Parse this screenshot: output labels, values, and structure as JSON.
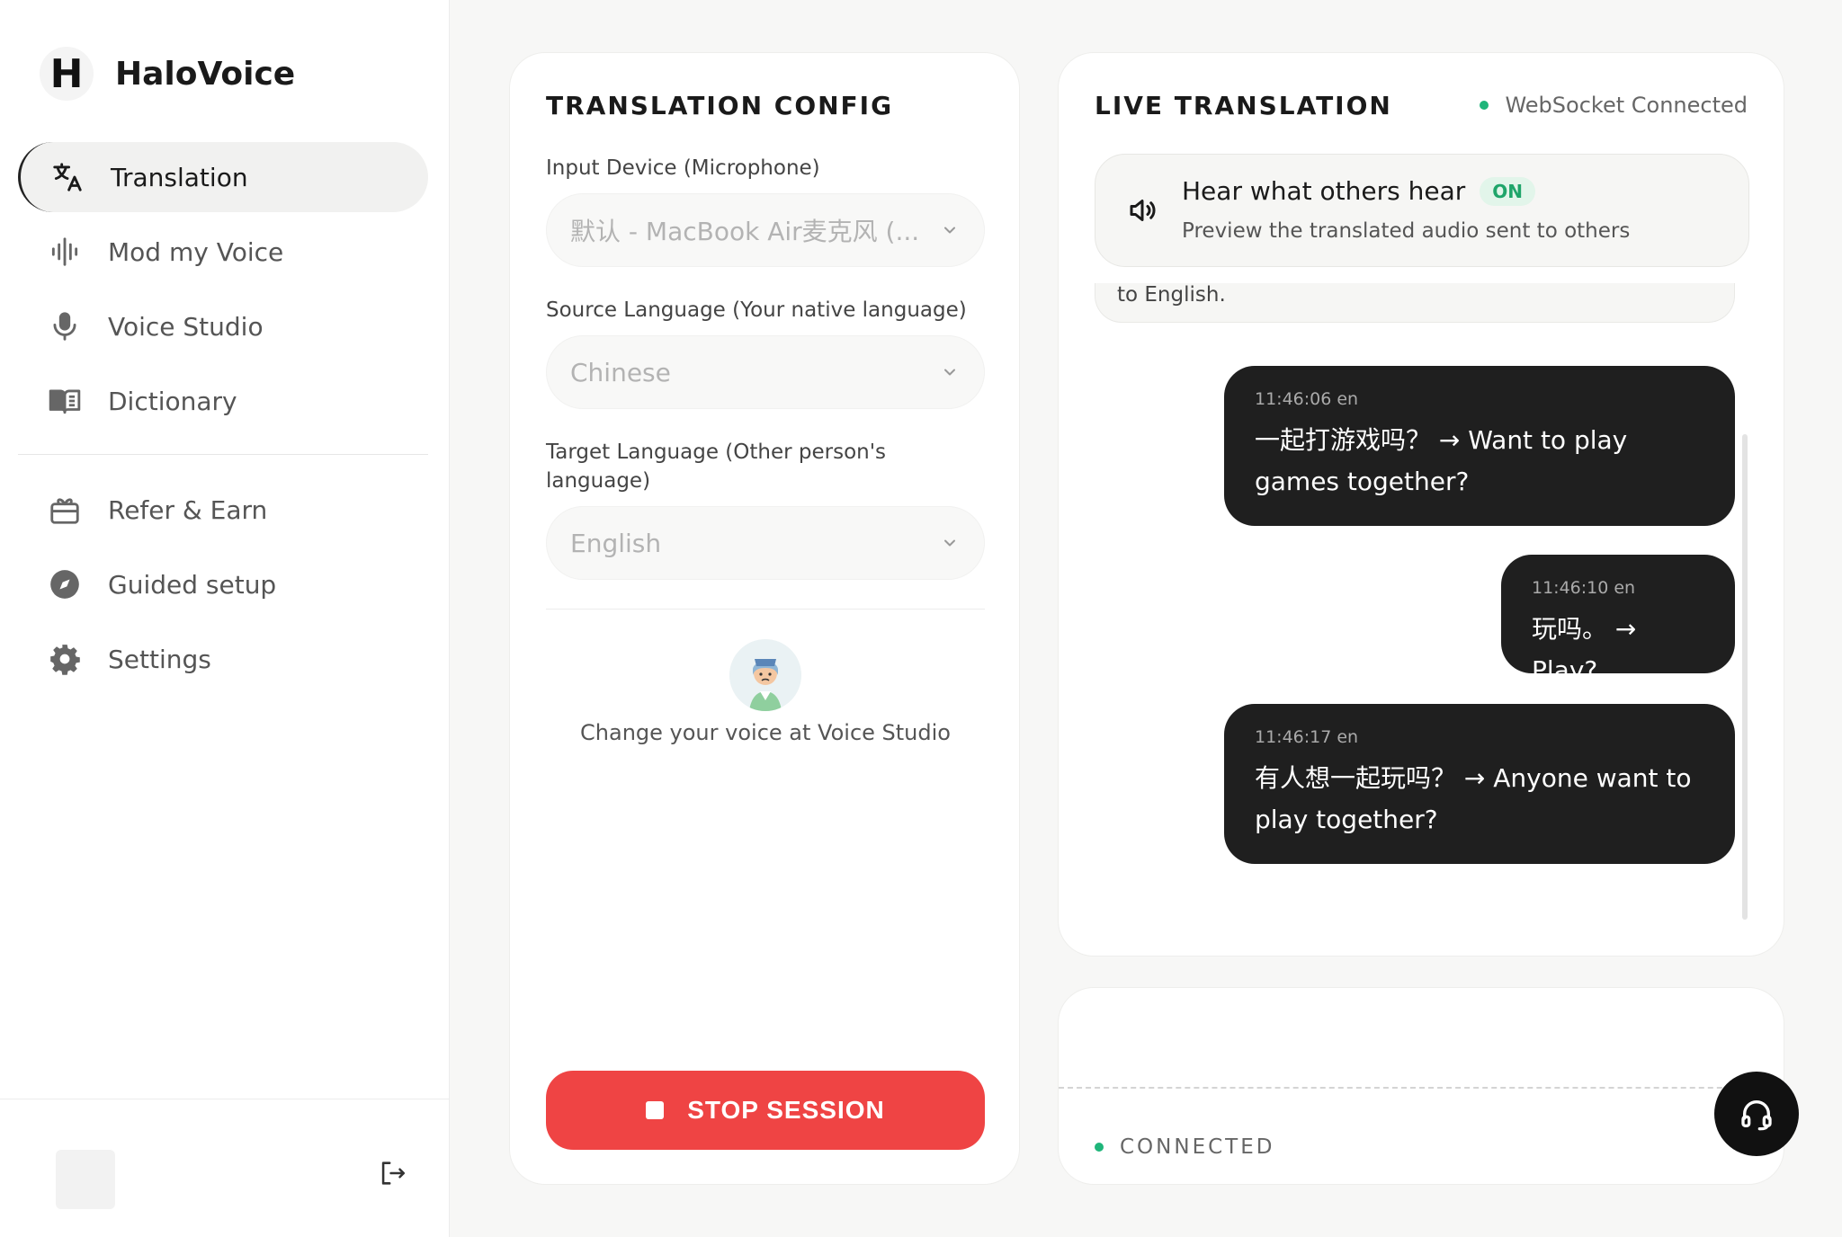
{
  "app": {
    "name": "HaloVoice",
    "logo_letter": "H"
  },
  "sidebar": {
    "items": [
      {
        "label": "Translation",
        "icon": "translate-icon",
        "active": true
      },
      {
        "label": "Mod my Voice",
        "icon": "waveform-icon"
      },
      {
        "label": "Voice Studio",
        "icon": "microphone-icon"
      },
      {
        "label": "Dictionary",
        "icon": "book-icon"
      }
    ],
    "secondary": [
      {
        "label": "Refer & Earn",
        "icon": "gift-icon"
      },
      {
        "label": "Guided setup",
        "icon": "compass-icon"
      },
      {
        "label": "Settings",
        "icon": "gear-icon"
      }
    ]
  },
  "config": {
    "title": "TRANSLATION CONFIG",
    "input_device_label": "Input Device (Microphone)",
    "input_device_value": "默认 - MacBook Air麦克风 (...",
    "source_label": "Source Language (Your native language)",
    "source_value": "Chinese",
    "target_label": "Target Language (Other person's language)",
    "target_value": "English",
    "voice_hint": "Change your voice at Voice Studio",
    "stop_label": "STOP SESSION"
  },
  "live": {
    "title": "LIVE TRANSLATION",
    "ws_status": "WebSocket Connected",
    "hear_title": "Hear what others hear",
    "hear_badge": "ON",
    "hear_sub": "Preview the translated audio sent to others",
    "prev_text": "to English.",
    "messages": [
      {
        "time": "11:46:06 en",
        "text": "一起打游戏吗？ → Want to play games together?"
      },
      {
        "time": "11:46:10 en",
        "text": "玩吗。 → Play?"
      },
      {
        "time": "11:46:17 en",
        "text": "有人想一起玩吗？ → Anyone want to play together?"
      }
    ]
  },
  "status": {
    "label": "CONNECTED"
  },
  "colors": {
    "accent_red": "#ef4444",
    "connected_green": "#1fb57a",
    "bubble_dark": "#1f1f1f"
  }
}
